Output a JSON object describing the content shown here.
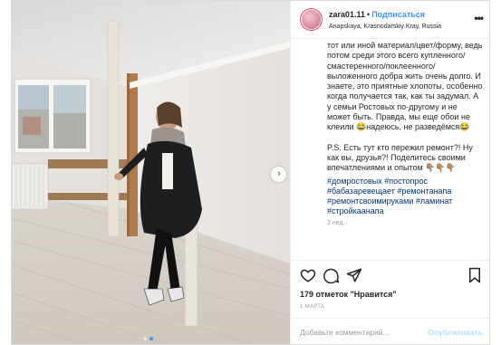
{
  "post": {
    "username": "zara01.11",
    "separator": "•",
    "follow_label": "Подписаться",
    "location": "Anapskaya, Krasnodarskiy Kray, Russia",
    "more_label": "•••"
  },
  "caption": {
    "paragraph1": "тот или иной материал/цвет/форму, ведь потом среди этого всего купленного/смастеренного/поклеенного/выложенного добра жить очень долго. И знаете, это приятные хлопоты, особенно когда получается так, как ты задумал. А у семьи Ростовых по-другому и не может быть. Правда, мы еще обои не клеили 😂надеюсь, не разведёмся😂",
    "paragraph2": "P.S. Есть тут кто пережил ремонт?! Ну как вы, друзья?! Поделитесь своими впечатлениями и опытом 👇🏽👇🏽👇🏽",
    "tags": "#домростовых #постопрос #бабазаревещает #ремонтанапа #ремонтсвоимируками #ламинат #стройкаанапа",
    "fade": "2 нед."
  },
  "actions": {
    "likes": "179 отметок \"Нравится\"",
    "date": "1 МАРТА"
  },
  "comment": {
    "placeholder": "Добавьте комментарий...",
    "publish_label": "Опубликовать"
  },
  "colors": {
    "accent": "#3897f0",
    "hashtag": "#003569",
    "publish_disabled": "#b2dffc"
  },
  "carousel": {
    "next_icon": "chevron-right-icon",
    "active_index": 1,
    "count": 2
  }
}
